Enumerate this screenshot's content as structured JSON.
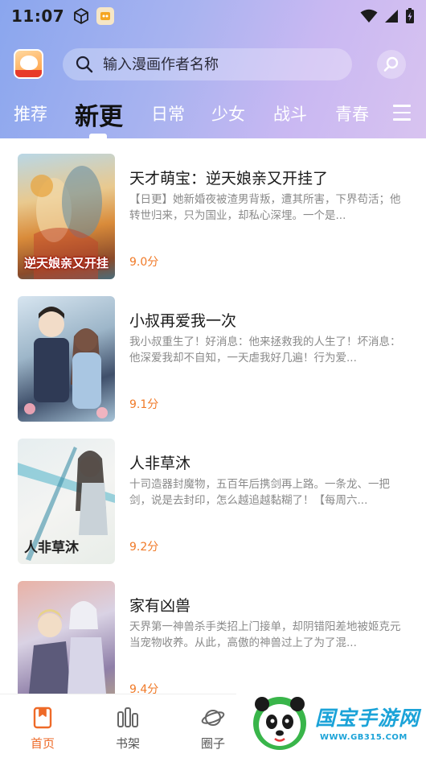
{
  "status_bar": {
    "time": "11:07"
  },
  "search": {
    "placeholder": "输入漫画作者名称"
  },
  "tabs": [
    {
      "label": "推荐"
    },
    {
      "label": "新更",
      "active": true
    },
    {
      "label": "日常"
    },
    {
      "label": "少女"
    },
    {
      "label": "战斗"
    },
    {
      "label": "青春"
    }
  ],
  "comics": [
    {
      "title": "天才萌宝：逆天娘亲又开挂了",
      "description": "【日更】她新婚夜被渣男背叛，遭其所害，下界苟活；他转世归来，只为国业，却私心深埋。一个是...",
      "score": "9.0分",
      "cover_text": "逆天娘亲又开挂"
    },
    {
      "title": "小叔再爱我一次",
      "description": "我小叔重生了！好消息：他来拯救我的人生了！坏消息：他深爱我却不自知，一天虐我好几遍！行为爱...",
      "score": "9.1分",
      "cover_text": ""
    },
    {
      "title": "人非草沐",
      "description": "十司造器封魔物，五百年后携剑再上路。一条龙、一把剑，说是去封印，怎么越追越黏糊了！【每周六...",
      "score": "9.2分",
      "cover_text": "人非草沐"
    },
    {
      "title": "家有凶兽",
      "description": "天界第一神兽杀手类招上门接单，却阴错阳差地被姬克元当宠物收养。从此，高傲的神兽过上了为了混...",
      "score": "9.4分",
      "cover_text": ""
    }
  ],
  "bottom_nav": [
    {
      "label": "首页",
      "icon": "home-icon",
      "active": true
    },
    {
      "label": "书架",
      "icon": "bookshelf-icon"
    },
    {
      "label": "圈子",
      "icon": "planet-icon"
    }
  ],
  "watermark": {
    "name": "国宝手游网",
    "url": "WWW.GB315.COM"
  },
  "colors": {
    "accent": "#ee6a28",
    "score": "#f07a28",
    "header_start": "#8aa6ee",
    "header_end": "#d8c3f0"
  }
}
